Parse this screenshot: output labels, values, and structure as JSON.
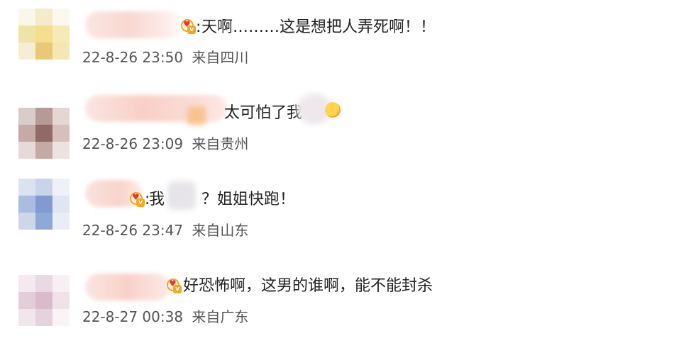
{
  "comments": [
    {
      "text_prefix": ":",
      "text": "天啊………这是想把人弄死啊！！",
      "date": "22-8-26 23:50",
      "location": "来自四川"
    },
    {
      "text_prefix": "",
      "text": "太可怕了我",
      "date": "22-8-26 23:09",
      "location": "来自贵州"
    },
    {
      "text_prefix": ":",
      "text_part1": "我",
      "text_part2": "？姐姐快跑！",
      "date": "22-8-26 23:47",
      "location": "来自山东"
    },
    {
      "text_prefix": "",
      "text": "好恐怖啊，这男的谁啊，能不能封杀",
      "date": "22-8-27 00:38",
      "location": "来自广东"
    }
  ],
  "colors": {
    "text": "#222222",
    "meta": "#555555",
    "badge_gold": "#f5a623",
    "badge_heart": "#e53935"
  },
  "icons": {
    "badge": "member-heart-badge-icon",
    "emoji": "smiley-emoji-icon"
  }
}
